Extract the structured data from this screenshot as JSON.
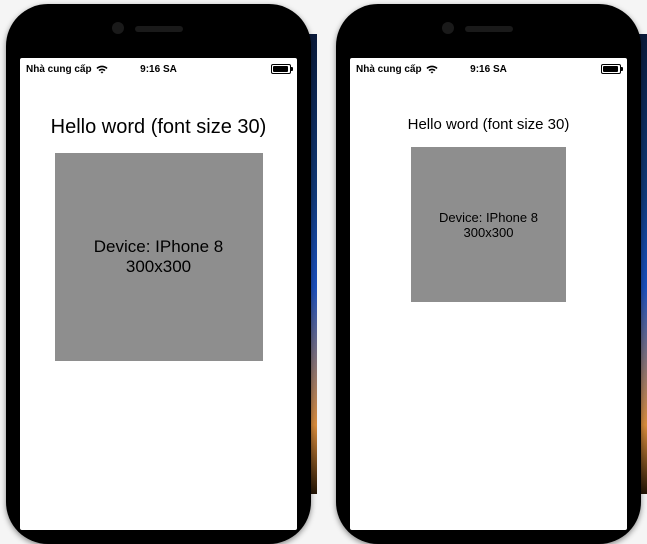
{
  "statusBar": {
    "carrier": "Nhà cung cấp",
    "time": "9:16 SA"
  },
  "phones": [
    {
      "title": "Hello word (font size 30)",
      "box_line1": "Device: IPhone 8",
      "box_line2": "300x300"
    },
    {
      "title": "Hello word (font size 30)",
      "box_line1": "Device: IPhone 8",
      "box_line2": "300x300"
    }
  ]
}
